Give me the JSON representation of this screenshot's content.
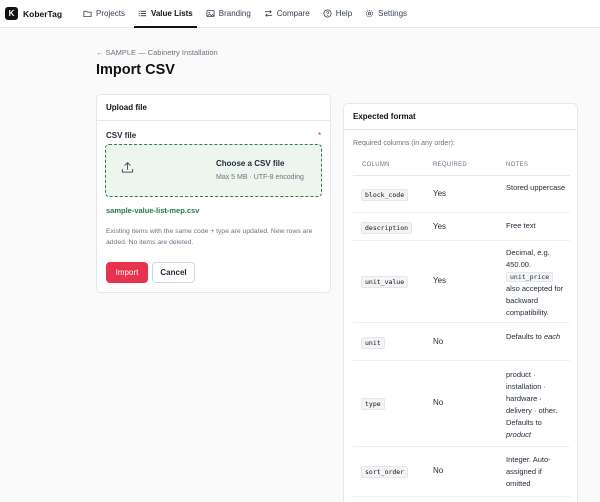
{
  "brand": {
    "logo_letter": "K",
    "name": "KoberTag"
  },
  "nav": [
    {
      "label": "Projects",
      "icon": "folder-icon",
      "active": false
    },
    {
      "label": "Value Lists",
      "icon": "list-icon",
      "active": true
    },
    {
      "label": "Branding",
      "icon": "image-icon",
      "active": false
    },
    {
      "label": "Compare",
      "icon": "arrows-compare-icon",
      "active": false
    },
    {
      "label": "Help",
      "icon": "help-circle-icon",
      "active": false
    },
    {
      "label": "Settings",
      "icon": "gear-icon",
      "active": false
    }
  ],
  "breadcrumb": {
    "back": "← SAMPLE — Cabinetry Installation"
  },
  "page_title": "Import CSV",
  "upload": {
    "header": "Upload file",
    "field_label": "CSV file",
    "required_marker": "*",
    "dropzone_title": "Choose a CSV file",
    "dropzone_sub": "Max 5 MB · UTF-8 encoding",
    "selected_file": "sample-value-list-mep.csv",
    "help": "Existing items with the same code + type are updated. New rows are added. No items are deleted.",
    "import_label": "Import",
    "cancel_label": "Cancel"
  },
  "format": {
    "header": "Expected format",
    "required_columns": "Required columns (in any order):",
    "columns": {
      "column": "COLUMN",
      "required": "REQUIRED",
      "notes": "NOTES"
    },
    "rows": [
      {
        "code": "block_code",
        "required": "Yes",
        "notes": "Stored uppercase"
      },
      {
        "code": "description",
        "required": "Yes",
        "notes": "Free text"
      },
      {
        "code": "unit_value",
        "required": "Yes",
        "notes_pre": "Decimal, e.g. 450.00.",
        "notes_code": "unit_price",
        "notes_post": "also accepted for backward compatibility."
      },
      {
        "code": "unit",
        "required": "No",
        "notes_pre": "Defaults to",
        "notes_em": "each"
      },
      {
        "code": "type",
        "required": "No",
        "notes_pre": "product · installation · hardware · delivery · other. Defaults to",
        "notes_em": "product"
      },
      {
        "code": "sort_order",
        "required": "No",
        "notes": "Integer. Auto-assigned if omitted"
      }
    ]
  },
  "colors": {
    "accent": "#e8334f",
    "dropzone_border": "#2e7d4f",
    "dropzone_bg": "#ecf6ef",
    "file_link": "#1f7a4a"
  }
}
